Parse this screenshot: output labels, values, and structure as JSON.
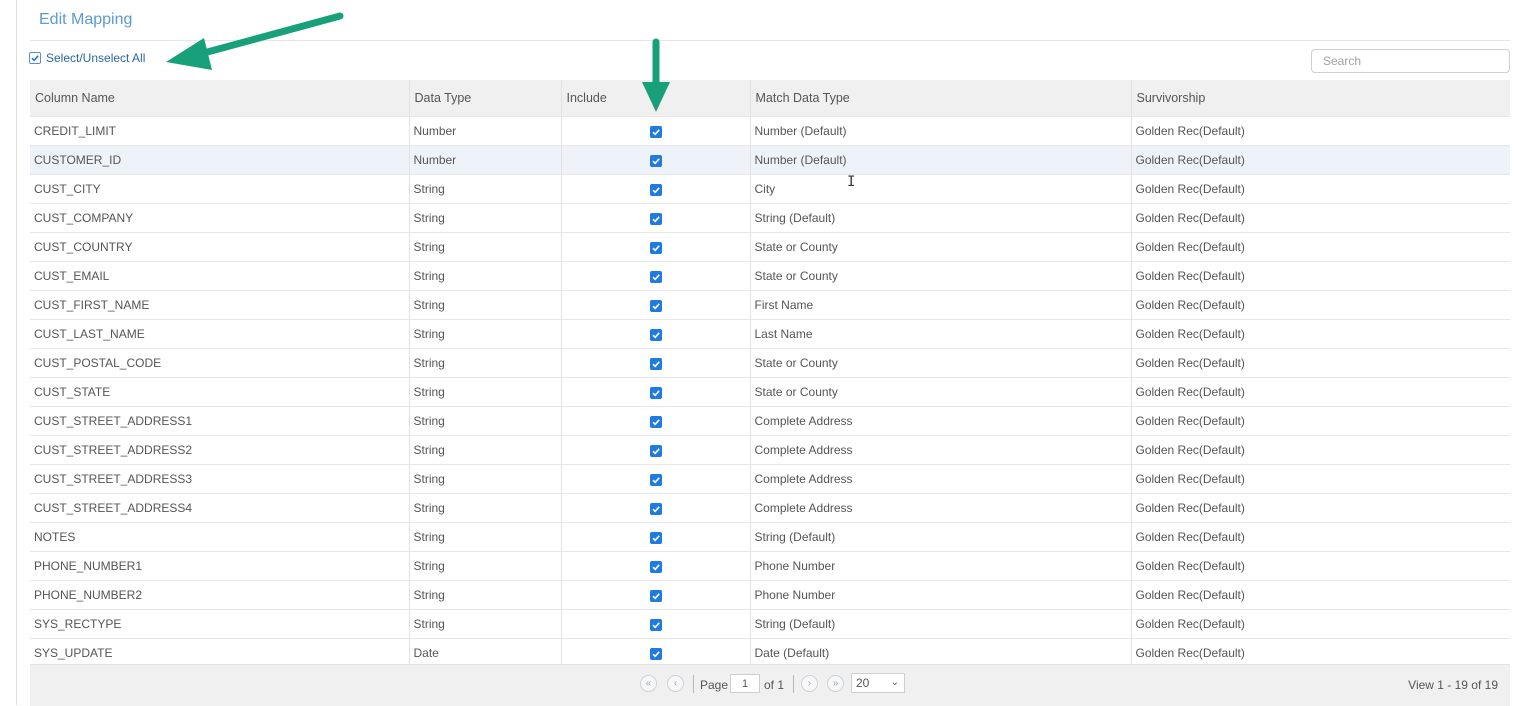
{
  "title": "Edit Mapping",
  "select_all": {
    "label": "Select/Unselect All",
    "checked": true
  },
  "search": {
    "placeholder": "Search",
    "value": ""
  },
  "columns": [
    "Column Name",
    "Data Type",
    "Include",
    "Match Data Type",
    "Survivorship"
  ],
  "rows": [
    {
      "column_name": "CREDIT_LIMIT",
      "data_type": "Number",
      "include": true,
      "match_data_type": "Number (Default)",
      "survivorship": "Golden Rec(Default)"
    },
    {
      "column_name": "CUSTOMER_ID",
      "data_type": "Number",
      "include": true,
      "match_data_type": "Number (Default)",
      "survivorship": "Golden Rec(Default)"
    },
    {
      "column_name": "CUST_CITY",
      "data_type": "String",
      "include": true,
      "match_data_type": "City",
      "survivorship": "Golden Rec(Default)"
    },
    {
      "column_name": "CUST_COMPANY",
      "data_type": "String",
      "include": true,
      "match_data_type": "String (Default)",
      "survivorship": "Golden Rec(Default)"
    },
    {
      "column_name": "CUST_COUNTRY",
      "data_type": "String",
      "include": true,
      "match_data_type": "State or County",
      "survivorship": "Golden Rec(Default)"
    },
    {
      "column_name": "CUST_EMAIL",
      "data_type": "String",
      "include": true,
      "match_data_type": "State or County",
      "survivorship": "Golden Rec(Default)"
    },
    {
      "column_name": "CUST_FIRST_NAME",
      "data_type": "String",
      "include": true,
      "match_data_type": "First Name",
      "survivorship": "Golden Rec(Default)"
    },
    {
      "column_name": "CUST_LAST_NAME",
      "data_type": "String",
      "include": true,
      "match_data_type": "Last Name",
      "survivorship": "Golden Rec(Default)"
    },
    {
      "column_name": "CUST_POSTAL_CODE",
      "data_type": "String",
      "include": true,
      "match_data_type": "State or County",
      "survivorship": "Golden Rec(Default)"
    },
    {
      "column_name": "CUST_STATE",
      "data_type": "String",
      "include": true,
      "match_data_type": "State or County",
      "survivorship": "Golden Rec(Default)"
    },
    {
      "column_name": "CUST_STREET_ADDRESS1",
      "data_type": "String",
      "include": true,
      "match_data_type": "Complete Address",
      "survivorship": "Golden Rec(Default)"
    },
    {
      "column_name": "CUST_STREET_ADDRESS2",
      "data_type": "String",
      "include": true,
      "match_data_type": "Complete Address",
      "survivorship": "Golden Rec(Default)"
    },
    {
      "column_name": "CUST_STREET_ADDRESS3",
      "data_type": "String",
      "include": true,
      "match_data_type": "Complete Address",
      "survivorship": "Golden Rec(Default)"
    },
    {
      "column_name": "CUST_STREET_ADDRESS4",
      "data_type": "String",
      "include": true,
      "match_data_type": "Complete Address",
      "survivorship": "Golden Rec(Default)"
    },
    {
      "column_name": "NOTES",
      "data_type": "String",
      "include": true,
      "match_data_type": "String (Default)",
      "survivorship": "Golden Rec(Default)"
    },
    {
      "column_name": "PHONE_NUMBER1",
      "data_type": "String",
      "include": true,
      "match_data_type": "Phone Number",
      "survivorship": "Golden Rec(Default)"
    },
    {
      "column_name": "PHONE_NUMBER2",
      "data_type": "String",
      "include": true,
      "match_data_type": "Phone Number",
      "survivorship": "Golden Rec(Default)"
    },
    {
      "column_name": "SYS_RECTYPE",
      "data_type": "String",
      "include": true,
      "match_data_type": "String (Default)",
      "survivorship": "Golden Rec(Default)"
    },
    {
      "column_name": "SYS_UPDATE",
      "data_type": "Date",
      "include": true,
      "match_data_type": "Date (Default)",
      "survivorship": "Golden Rec(Default)"
    }
  ],
  "highlighted_row": 1,
  "pager": {
    "page_label": "Page",
    "page_value": "1",
    "of_label": "of 1",
    "page_size": "20",
    "view_text": "View 1 - 19 of 19"
  },
  "icons": {
    "first": "«",
    "prev": "‹",
    "next": "›",
    "last": "»",
    "caret": "⌄"
  },
  "colors": {
    "accent": "#1f7be0",
    "title": "#5b9bd1",
    "link": "#2a67a8",
    "annotation_arrow": "#17a07a",
    "header_bg": "#f0f0f0",
    "row_highlight": "#eef3fa"
  }
}
